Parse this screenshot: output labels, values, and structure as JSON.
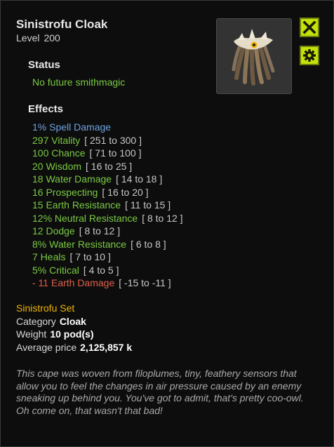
{
  "item": {
    "name": "Sinistrofu Cloak",
    "level_label": "Level",
    "level_value": "200",
    "image_name": "cloak-feather-icon"
  },
  "buttons": {
    "close": "close-icon",
    "settings": "gear-icon"
  },
  "status": {
    "title": "Status",
    "text": "No future smithmagic"
  },
  "effects": {
    "title": "Effects",
    "items": [
      {
        "name": "1% Spell Damage",
        "range": "",
        "color": "blue"
      },
      {
        "name": "297 Vitality",
        "range": "[ 251 to 300 ]",
        "color": "pos"
      },
      {
        "name": "100 Chance",
        "range": "[ 71 to 100 ]",
        "color": "pos"
      },
      {
        "name": "20 Wisdom",
        "range": "[ 16 to 25 ]",
        "color": "pos"
      },
      {
        "name": "18 Water Damage",
        "range": "[ 14 to 18 ]",
        "color": "pos"
      },
      {
        "name": "16 Prospecting",
        "range": "[ 16 to 20 ]",
        "color": "pos"
      },
      {
        "name": "15 Earth Resistance",
        "range": "[ 11 to 15 ]",
        "color": "pos"
      },
      {
        "name": "12% Neutral Resistance",
        "range": "[ 8 to 12 ]",
        "color": "pos"
      },
      {
        "name": "12 Dodge",
        "range": "[ 8 to 12 ]",
        "color": "pos"
      },
      {
        "name": "8% Water Resistance",
        "range": "[ 6 to 8 ]",
        "color": "pos"
      },
      {
        "name": "7 Heals",
        "range": "[ 7 to 10 ]",
        "color": "pos"
      },
      {
        "name": "5% Critical",
        "range": "[ 4 to 5 ]",
        "color": "pos"
      },
      {
        "name": "- 11 Earth Damage",
        "range": "[ -15 to -11 ]",
        "color": "neg"
      }
    ]
  },
  "set": {
    "name": "Sinistrofu Set"
  },
  "details": {
    "category_label": "Category",
    "category_value": "Cloak",
    "weight_label": "Weight",
    "weight_value": "10 pod(s)",
    "price_label": "Average price",
    "price_value": "2,125,857 k"
  },
  "description": "This cape was woven from filoplumes, tiny, feathery sensors that allow you to feel the changes in air pressure caused by an enemy sneaking up behind you. You've got to admit, that's pretty coo-owl. Oh come on, that wasn't that bad!",
  "colors": {
    "accent_button": "#c3e20a",
    "positive_effect": "#7ac943",
    "spell_effect": "#6fa3e0",
    "negative_effect": "#e0604a",
    "set_name": "#f0b400"
  }
}
